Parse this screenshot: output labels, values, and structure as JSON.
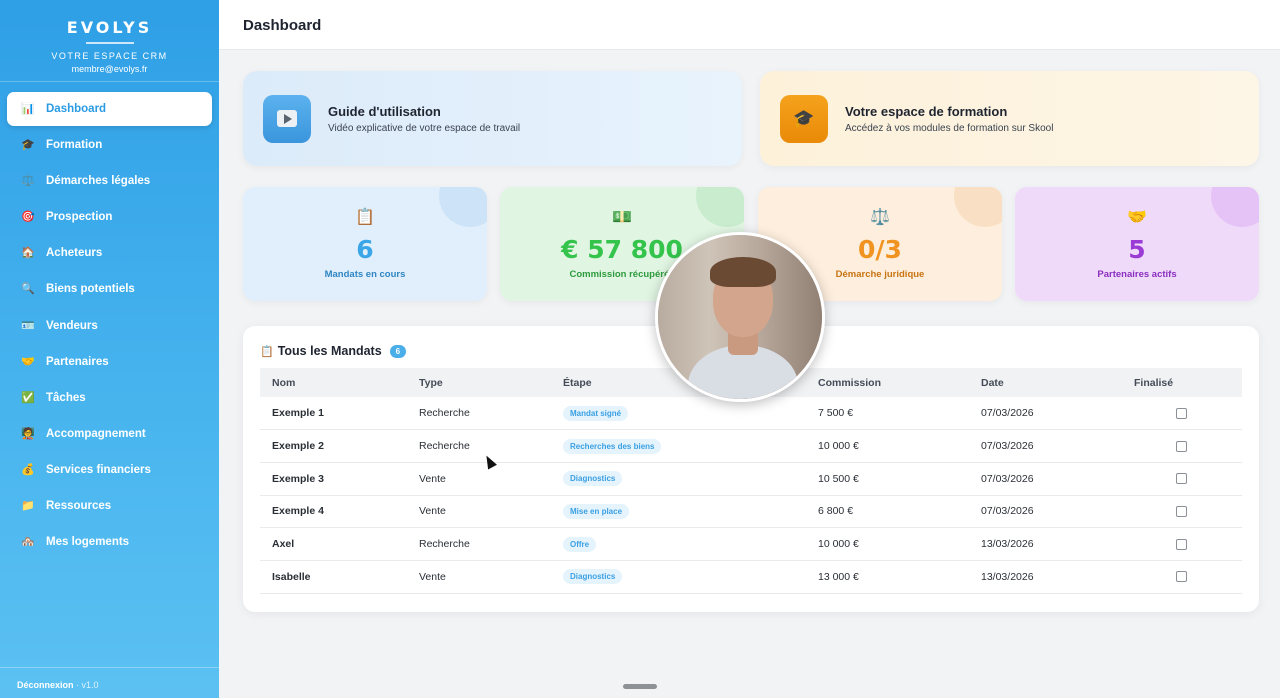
{
  "sidebar": {
    "brand": "EVOLYS",
    "tagline": "VOTRE ESPACE CRM",
    "email": "membre@evolys.fr",
    "items": [
      {
        "label": "Dashboard",
        "icon": "📊"
      },
      {
        "label": "Formation",
        "icon": "🎓"
      },
      {
        "label": "Démarches légales",
        "icon": "⚖️"
      },
      {
        "label": "Prospection",
        "icon": "🎯"
      },
      {
        "label": "Acheteurs",
        "icon": "🏠"
      },
      {
        "label": "Biens potentiels",
        "icon": "🔍"
      },
      {
        "label": "Vendeurs",
        "icon": "🪪"
      },
      {
        "label": "Partenaires",
        "icon": "🤝"
      },
      {
        "label": "Tâches",
        "icon": "✅"
      },
      {
        "label": "Accompagnement",
        "icon": "🧑‍🏫"
      },
      {
        "label": "Services financiers",
        "icon": "💰"
      },
      {
        "label": "Ressources",
        "icon": "📁"
      },
      {
        "label": "Mes logements",
        "icon": "🏘️"
      }
    ],
    "footer_logout": "Déconnexion",
    "footer_version": "· v1.0"
  },
  "header": {
    "title": "Dashboard"
  },
  "features": {
    "guide": {
      "title": "Guide d'utilisation",
      "subtitle": "Vidéo explicative de votre espace de travail"
    },
    "training": {
      "title": "Votre espace de formation",
      "subtitle": "Accédez à vos modules de formation sur Skool",
      "icon": "🎓"
    }
  },
  "stats": [
    {
      "icon": "📋",
      "value": "6",
      "label": "Mandats en cours"
    },
    {
      "icon": "💵",
      "value": "€ 57 800",
      "label": "Commission récupérée"
    },
    {
      "icon": "⚖️",
      "value": "0/3",
      "label": "Démarche juridique"
    },
    {
      "icon": "🤝",
      "value": "5",
      "label": "Partenaires actifs"
    }
  ],
  "mandats": {
    "icon": "📋",
    "title": "Tous les Mandats",
    "count": "6",
    "columns": [
      "Nom",
      "Type",
      "Étape",
      "Commission",
      "Date",
      "Finalisé"
    ],
    "rows": [
      {
        "nom": "Exemple 1",
        "type": "Recherche",
        "etape": "Mandat signé",
        "commission": "7 500 €",
        "date": "07/03/2026",
        "finalise": false
      },
      {
        "nom": "Exemple 2",
        "type": "Recherche",
        "etape": "Recherches des biens",
        "commission": "10 000 €",
        "date": "07/03/2026",
        "finalise": false
      },
      {
        "nom": "Exemple 3",
        "type": "Vente",
        "etape": "Diagnostics",
        "commission": "10 500 €",
        "date": "07/03/2026",
        "finalise": false
      },
      {
        "nom": "Exemple 4",
        "type": "Vente",
        "etape": "Mise en place",
        "commission": "6 800 €",
        "date": "07/03/2026",
        "finalise": false
      },
      {
        "nom": "Axel",
        "type": "Recherche",
        "etape": "Offre",
        "commission": "10 000 €",
        "date": "13/03/2026",
        "finalise": false
      },
      {
        "nom": "Isabelle",
        "type": "Vente",
        "etape": "Diagnostics",
        "commission": "13 000 €",
        "date": "13/03/2026",
        "finalise": false
      }
    ]
  }
}
